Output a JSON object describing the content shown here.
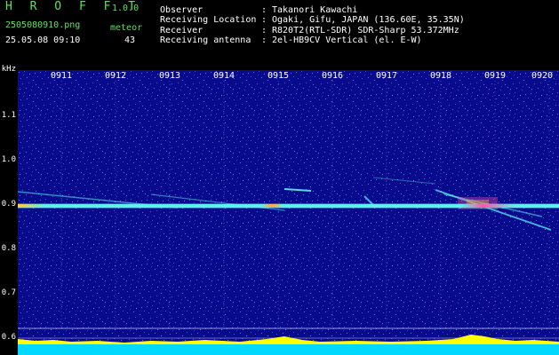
{
  "app": {
    "name": "H R O F F T",
    "version": "1.0.0"
  },
  "file": {
    "name": "2505080910.png",
    "datetime": "25.05.08 09:10"
  },
  "meteor": {
    "label": "meteor",
    "count": "43"
  },
  "info": [
    {
      "key": "Observer",
      "sep": ": ",
      "value": "Takanori Kawachi"
    },
    {
      "key": "Receiving Location",
      "sep": ": ",
      "value": "Ogaki, Gifu, JAPAN (136.60E, 35.35N)"
    },
    {
      "key": "Receiver",
      "sep": ": ",
      "value": "R820T2(RTL-SDR) SDR-Sharp 53.372MHz"
    },
    {
      "key": "Receiving antenna",
      "sep": ": ",
      "value": "2el-HB9CV Vertical (el. E-W)"
    }
  ],
  "axis": {
    "unit": "kHz",
    "y_ticks": [
      "1.1",
      "1.0",
      "0.9",
      "0.8",
      "0.7",
      "0.6"
    ],
    "x_ticks": [
      "0911",
      "0912",
      "0913",
      "0914",
      "0915",
      "0916",
      "0917",
      "0918",
      "0919",
      "0920"
    ]
  },
  "colors": {
    "background": "#0a0a8c",
    "noise_blue": "#3a7bff",
    "carrier": "#5cf0f0",
    "title_green": "#5fe05f",
    "bottom_bar": "#00d8ff",
    "bottom_peak": "#ffff00"
  }
}
